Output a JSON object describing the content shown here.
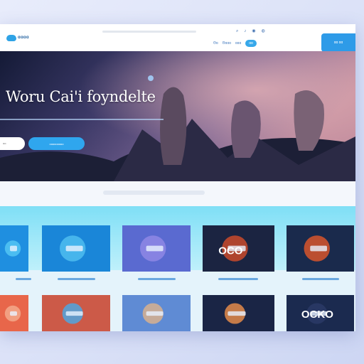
{
  "header": {
    "logo_text": "ɑɑɑɑ",
    "top_icons": [
      "search-icon",
      "bell-icon",
      "user-icon",
      "globe-icon"
    ],
    "links": [
      "Θɑ",
      "Θɑɑɑ",
      "ɑɑɑ"
    ],
    "active_pill": "ɑɑ",
    "cta": "ɑɑ ɑɑ"
  },
  "hero": {
    "title": "Woru Cai'i foyndelte",
    "input_placeholder": "ɑɑ",
    "button_label": "ɑɑɑɑɑɑɑɑɑ"
  },
  "cards": [
    {
      "text": ""
    },
    {
      "text": ""
    },
    {
      "text": ""
    },
    {
      "text": "OCO"
    },
    {
      "text": ""
    },
    {
      "text": ""
    },
    {
      "text": ""
    },
    {
      "text": ""
    },
    {
      "text": ""
    },
    {
      "text": "OCKO"
    }
  ],
  "colors": {
    "accent": "#2fa6ee",
    "nav_link": "#4a7fc1",
    "hero_dark": "#1b2140",
    "hero_glow": "#c88a9e"
  }
}
